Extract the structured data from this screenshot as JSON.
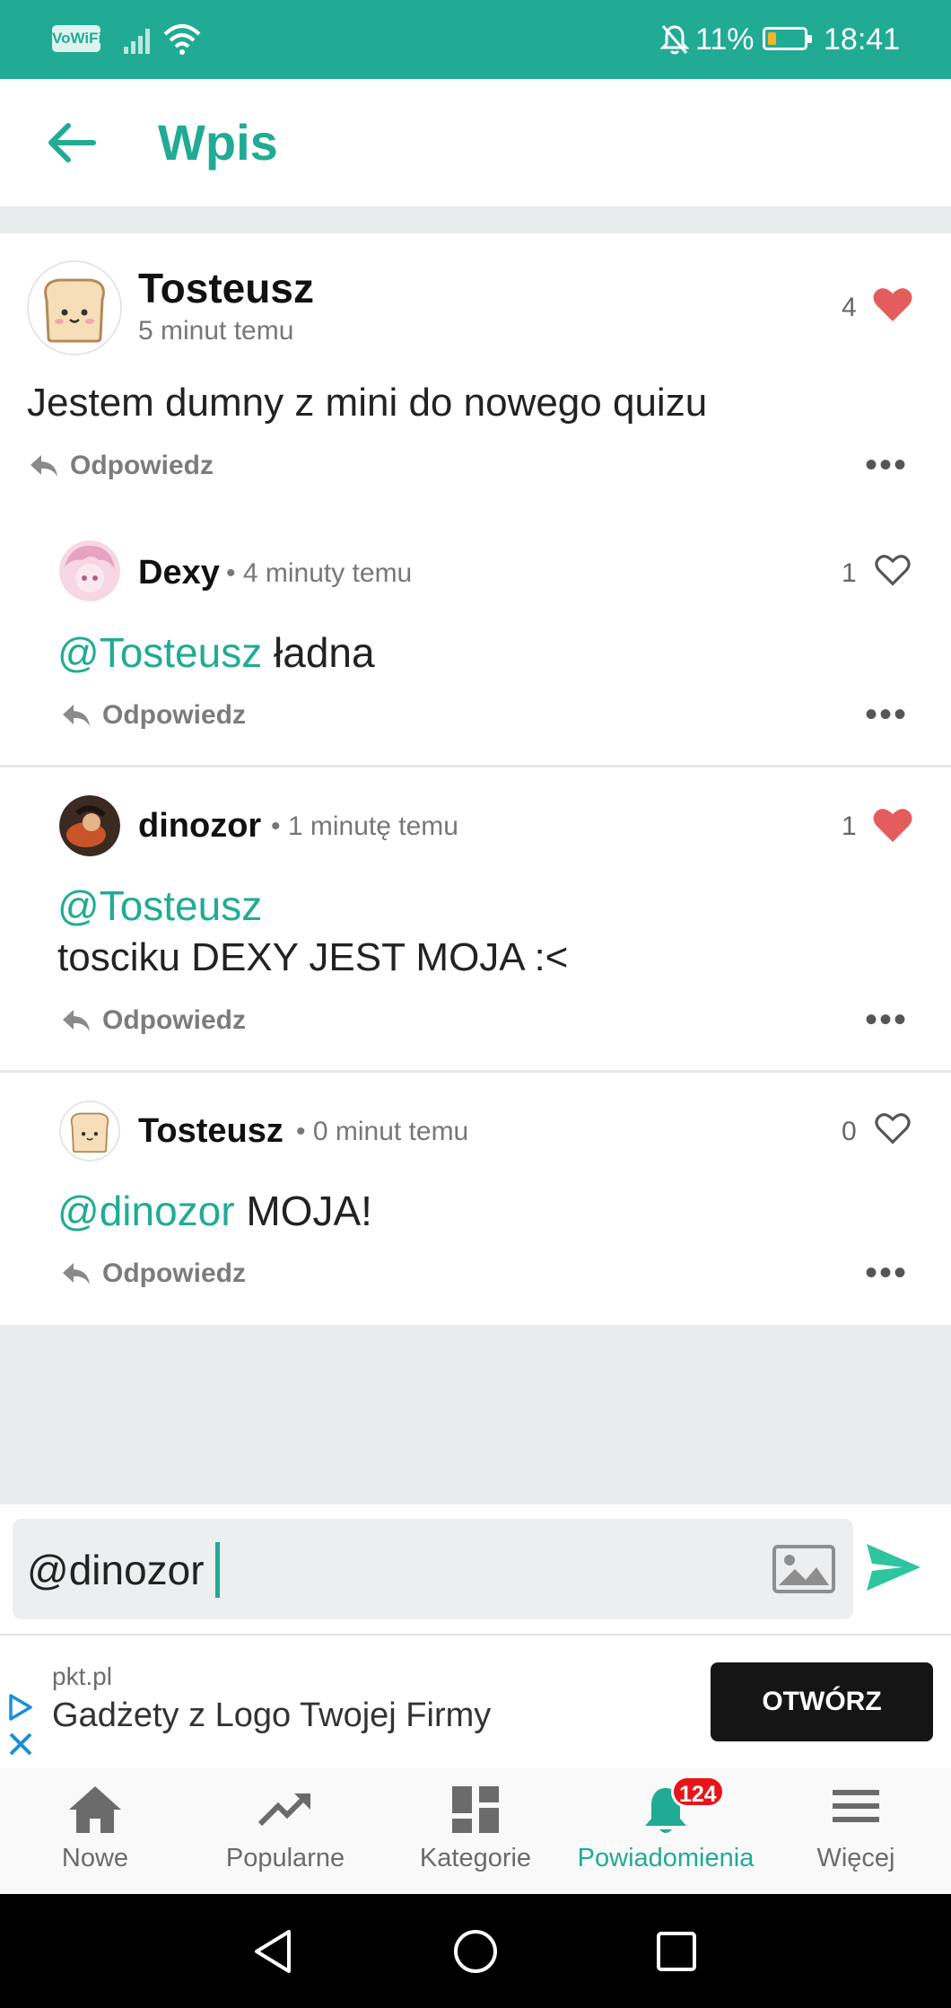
{
  "status_bar": {
    "vowifi": "VoWiFi",
    "battery_percent": "11%",
    "battery_level": 0.11,
    "time": "18:41",
    "icons": [
      "signal-icon",
      "wifi-icon",
      "notifications-off-icon",
      "battery-icon"
    ]
  },
  "app_bar": {
    "title": "Wpis",
    "back_icon": "arrow-left-icon"
  },
  "post": {
    "author": "Tosteusz",
    "time": "5 minut temu",
    "likes": "4",
    "liked": true,
    "text": "Jestem dumny z mini do nowego quizu",
    "reply_label": "Odpowiedz"
  },
  "comments": [
    {
      "author": "Dexy",
      "time": "• 4 minuty temu",
      "likes": "1",
      "liked": false,
      "mention": "@Tosteusz",
      "text": " ładna",
      "reply_label": "Odpowiedz"
    },
    {
      "author": "dinozor",
      "time": "• 1 minutę temu",
      "likes": "1",
      "liked": true,
      "mention": "@Tosteusz",
      "text": "tosciku DEXY JEST MOJA :<",
      "reply_label": "Odpowiedz"
    },
    {
      "author": "Tosteusz",
      "time": "• 0 minut temu",
      "likes": "0",
      "liked": false,
      "mention": "@dinozor",
      "text": " MOJA!",
      "reply_label": "Odpowiedz"
    }
  ],
  "composer": {
    "value": "@dinozor"
  },
  "ad": {
    "domain": "pkt.pl",
    "headline": "Gadżety z Logo Twojej Firmy",
    "button": "OTWÓRZ"
  },
  "bottom_nav": {
    "items": [
      {
        "label": "Nowe",
        "icon": "home-icon"
      },
      {
        "label": "Popularne",
        "icon": "trending-icon"
      },
      {
        "label": "Kategorie",
        "icon": "dashboard-icon"
      },
      {
        "label": "Powiadomienia",
        "icon": "bell-icon",
        "badge": "124",
        "active": true
      },
      {
        "label": "Więcej",
        "icon": "menu-icon"
      }
    ]
  },
  "colors": {
    "accent": "#21ab95",
    "like": "#e35d5d",
    "badge": "#e8141a"
  }
}
